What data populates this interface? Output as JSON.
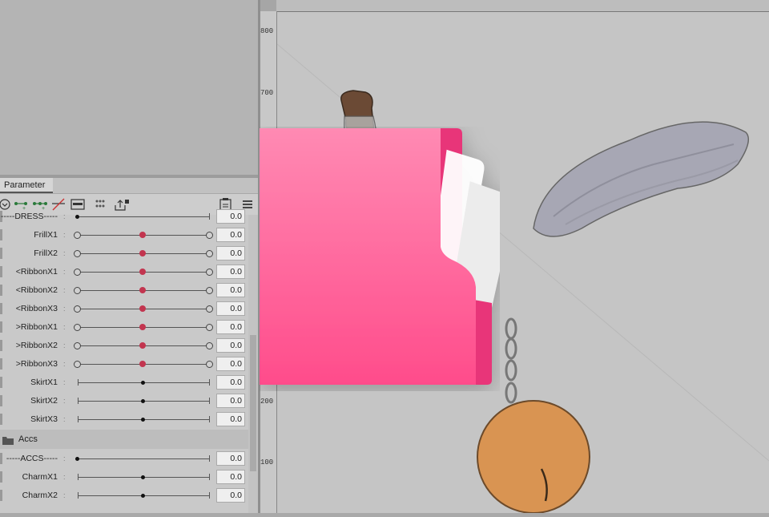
{
  "panel": {
    "tab_label": "Parameter"
  },
  "ruler": {
    "marks": [
      "800",
      "700",
      "200",
      "100"
    ]
  },
  "rows": [
    {
      "label": "-----DRESS-----",
      "value": "0.0",
      "type": "left"
    },
    {
      "label": "FrillX1",
      "value": "0.0",
      "type": "mid3"
    },
    {
      "label": "FrillX2",
      "value": "0.0",
      "type": "mid3"
    },
    {
      "label": "<RibbonX1",
      "value": "0.0",
      "type": "mid3"
    },
    {
      "label": "<RibbonX2",
      "value": "0.0",
      "type": "mid3"
    },
    {
      "label": "<RibbonX3",
      "value": "0.0",
      "type": "mid3"
    },
    {
      "label": ">RibbonX1",
      "value": "0.0",
      "type": "mid3"
    },
    {
      "label": ">RibbonX2",
      "value": "0.0",
      "type": "mid3"
    },
    {
      "label": ">RibbonX3",
      "value": "0.0",
      "type": "mid3"
    },
    {
      "label": "SkirtX1",
      "value": "0.0",
      "type": "mid2"
    },
    {
      "label": "SkirtX2",
      "value": "0.0",
      "type": "mid2"
    },
    {
      "label": "SkirtX3",
      "value": "0.0",
      "type": "mid2"
    }
  ],
  "group": {
    "label": "Accs"
  },
  "rows2": [
    {
      "label": "-----ACCS-----",
      "value": "0.0",
      "type": "left"
    },
    {
      "label": "CharmX1",
      "value": "0.0",
      "type": "mid2"
    },
    {
      "label": "CharmX2",
      "value": "0.0",
      "type": "mid2"
    }
  ],
  "colors": {
    "folder_pink": "#ff5b98",
    "keyform_dot": "#c2354f"
  },
  "icons": [
    "collapse-icon",
    "add-keyform-icon",
    "add-three-keyforms-icon",
    "delete-keyform-icon",
    "parameter-value-icon",
    "blend-shape-icon",
    "export-lock-icon",
    "copy-parameter-icon",
    "menu-icon",
    "folder-icon"
  ]
}
